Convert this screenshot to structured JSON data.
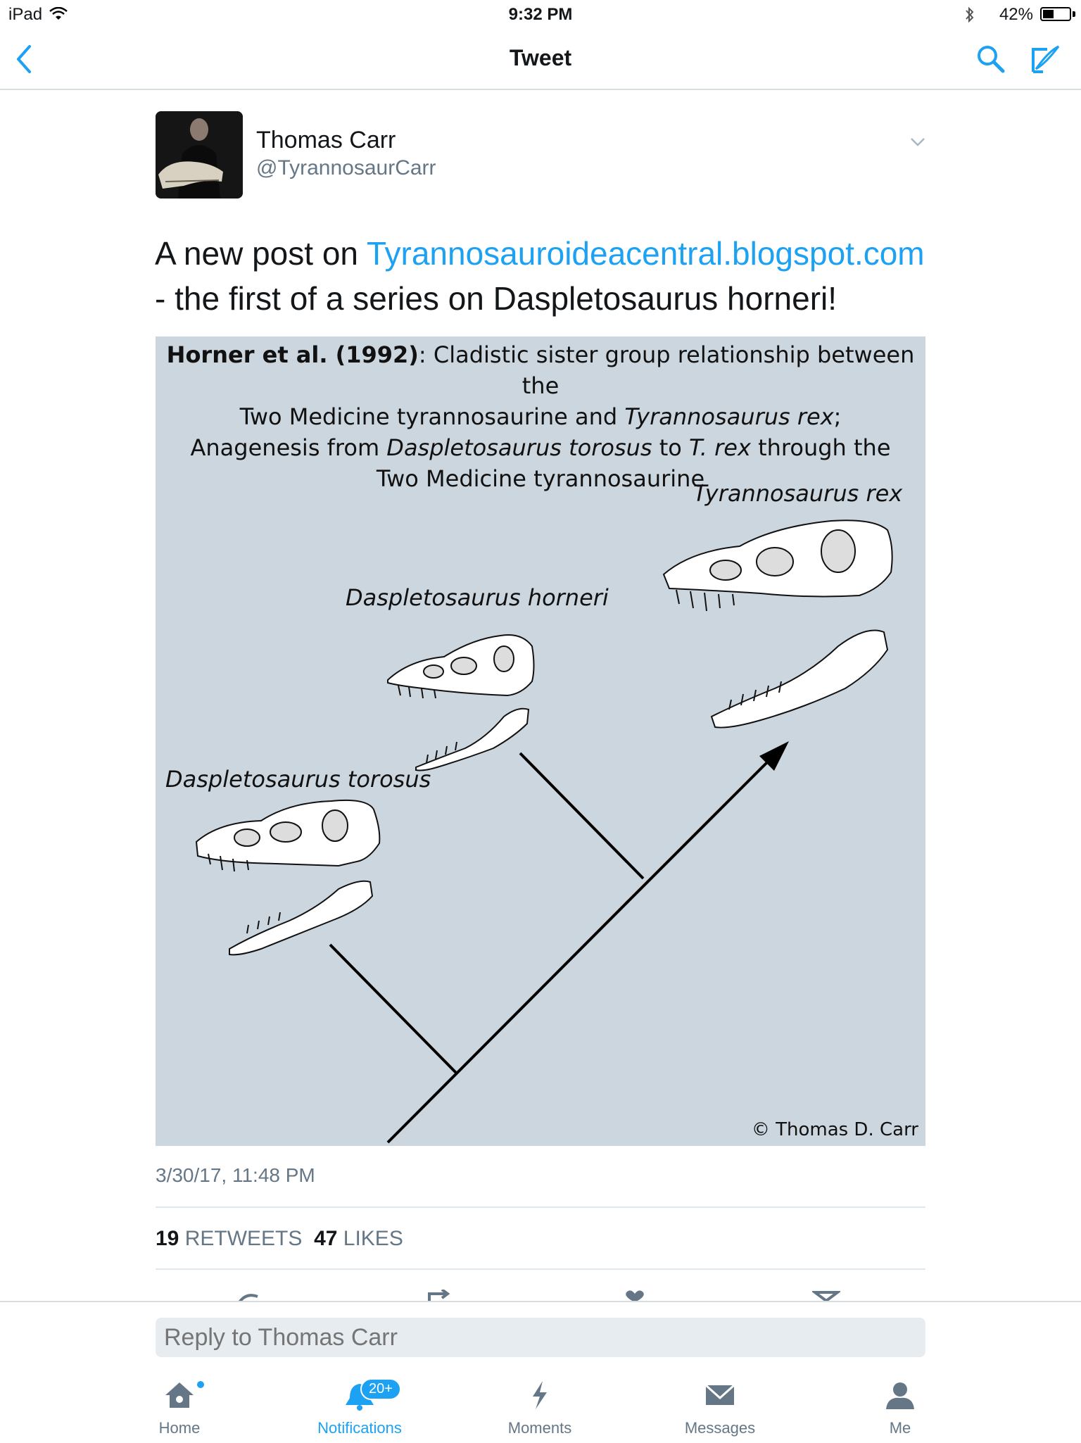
{
  "status_bar": {
    "carrier": "iPad",
    "time": "9:32 PM",
    "battery_pct": "42%",
    "battery_level": 0.42
  },
  "nav": {
    "title": "Tweet",
    "icons": [
      "back-chevron-icon",
      "search-icon",
      "compose-icon"
    ],
    "accent": "#1da1f2"
  },
  "tweet": {
    "author_name": "Thomas Carr",
    "author_handle": "@TyrannosaurCarr",
    "text_before": "A new post on ",
    "link": "Tyrannosauroideacentral.blogspot.com",
    "text_after": "- the first of a series on Daspletosaurus horneri!",
    "timestamp": "3/30/17, 11:48 PM",
    "retweet_count": "19",
    "retweet_label": "RETWEETS",
    "like_count": "47",
    "like_label": "LIKES"
  },
  "media": {
    "caption_bold": "Horner et al. (1992)",
    "caption_line1": ": Cladistic sister group relationship between the",
    "caption_line2a": "Two Medicine tyrannosaurine and ",
    "caption_line2b": "Tyrannosaurus rex",
    "caption_line2c": ";",
    "caption_line3a": "Anagenesis from ",
    "caption_line3b": "Daspletosaurus torosus",
    "caption_line3c": " to ",
    "caption_line3d": "T. rex",
    "caption_line3e": " through the",
    "caption_line4": "Two Medicine tyrannosaurine",
    "species": [
      "Daspletosaurus torosus",
      "Daspletosaurus horneri",
      "Tyrannosaurus rex"
    ],
    "copyright": "© Thomas D. Carr"
  },
  "reply": {
    "placeholder": "Reply to Thomas Carr"
  },
  "tabs": [
    {
      "label": "Home",
      "icon": "home-icon"
    },
    {
      "label": "Notifications",
      "icon": "bell-icon",
      "badge": "20+"
    },
    {
      "label": "Moments",
      "icon": "lightning-icon"
    },
    {
      "label": "Messages",
      "icon": "envelope-icon"
    },
    {
      "label": "Me",
      "icon": "person-icon"
    }
  ]
}
